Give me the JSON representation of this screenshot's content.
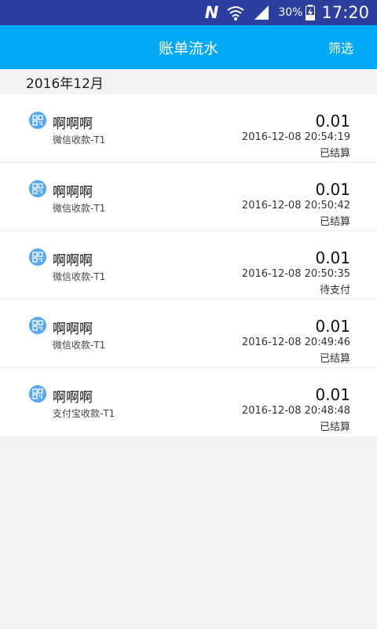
{
  "status_bar": {
    "n_icon": "N",
    "battery": "30%",
    "time": "17:20"
  },
  "app_bar": {
    "title": "账单流水",
    "filter_label": "筛选"
  },
  "month": "2016年12月",
  "transactions": [
    {
      "name": "啊啊啊",
      "channel": "微信收款-T1",
      "amount": "0.01",
      "time": "2016-12-08 20:54:19",
      "status": "已结算"
    },
    {
      "name": "啊啊啊",
      "channel": "微信收款-T1",
      "amount": "0.01",
      "time": "2016-12-08 20:50:42",
      "status": "已结算"
    },
    {
      "name": "啊啊啊",
      "channel": "微信收款-T1",
      "amount": "0.01",
      "time": "2016-12-08 20:50:35",
      "status": "待支付"
    },
    {
      "name": "啊啊啊",
      "channel": "微信收款-T1",
      "amount": "0.01",
      "time": "2016-12-08 20:49:46",
      "status": "已结算"
    },
    {
      "name": "啊啊啊",
      "channel": "支付宝收款-T1",
      "amount": "0.01",
      "time": "2016-12-08 20:48:48",
      "status": "已结算"
    }
  ],
  "colors": {
    "status_bar": "#2c3e9e",
    "app_bar": "#03a9f4",
    "icon": "#5aa9ee",
    "background": "#f2f2f2"
  }
}
